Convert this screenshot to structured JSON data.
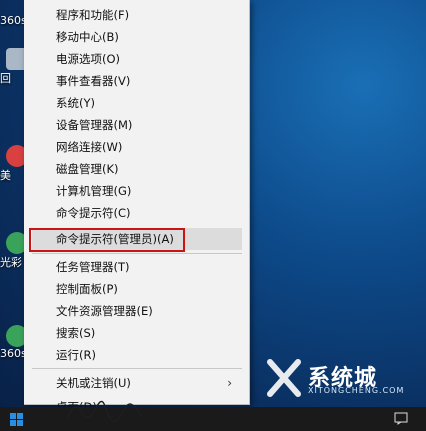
{
  "desktop": {
    "icons": [
      {
        "label": "360s",
        "color": "#4a90d9"
      },
      {
        "label": "回",
        "color": "#c0c0c0"
      },
      {
        "label": "美",
        "color": "#d94040"
      },
      {
        "label": "光彩",
        "color": "#3aa35a"
      },
      {
        "label": "360s",
        "color": "#4a90d9"
      }
    ]
  },
  "menu": {
    "items": [
      {
        "label": "程序和功能(F)"
      },
      {
        "label": "移动中心(B)"
      },
      {
        "label": "电源选项(O)"
      },
      {
        "label": "事件查看器(V)"
      },
      {
        "label": "系统(Y)"
      },
      {
        "label": "设备管理器(M)"
      },
      {
        "label": "网络连接(W)"
      },
      {
        "label": "磁盘管理(K)"
      },
      {
        "label": "计算机管理(G)"
      },
      {
        "label": "命令提示符(C)"
      },
      {
        "label": "命令提示符(管理员)(A)"
      },
      {
        "label": "任务管理器(T)"
      },
      {
        "label": "控制面板(P)"
      },
      {
        "label": "文件资源管理器(E)"
      },
      {
        "label": "搜索(S)"
      },
      {
        "label": "运行(R)"
      },
      {
        "label": "关机或注销(U)"
      },
      {
        "label": "桌面(D)"
      }
    ],
    "highlight_color": "#dcdcdc",
    "annotation_color": "#c81414"
  },
  "watermark": {
    "brand": "系统城",
    "sub": "XITONGCHENG.COM"
  },
  "taskbar": {
    "start_icon": "windows-logo-icon",
    "tray_icon": "action-center-icon"
  }
}
